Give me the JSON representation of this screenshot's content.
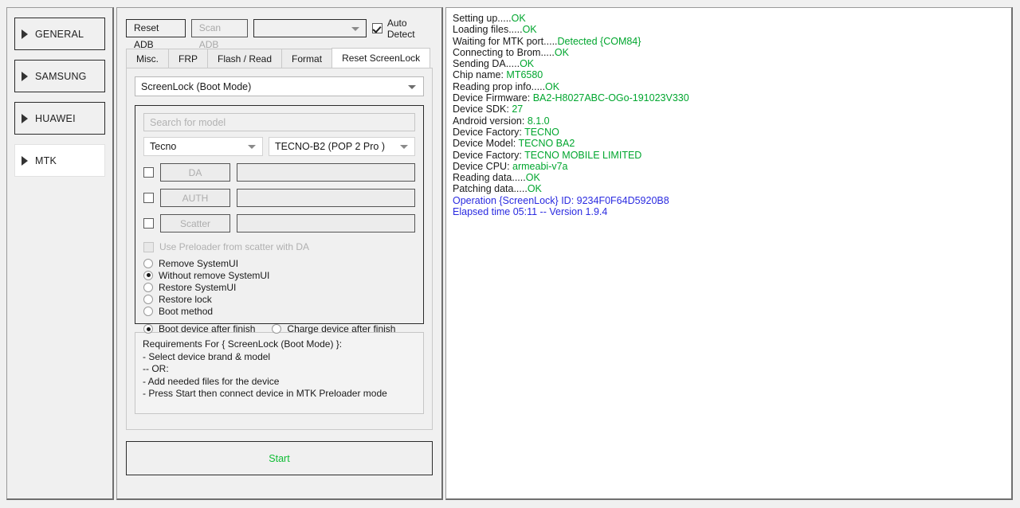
{
  "sidebar": {
    "items": [
      {
        "label": "GENERAL",
        "selected": false
      },
      {
        "label": "SAMSUNG",
        "selected": false
      },
      {
        "label": "HUAWEI",
        "selected": false
      },
      {
        "label": "MTK",
        "selected": true
      }
    ]
  },
  "toolbar": {
    "reset_adb_label": "Reset ADB",
    "scan_adb_label": "Scan ADB",
    "port_value": "",
    "auto_detect_label": "Auto Detect",
    "auto_detect_checked": true
  },
  "tabs": [
    {
      "label": "Misc.",
      "active": false
    },
    {
      "label": "FRP",
      "active": false
    },
    {
      "label": "Flash / Read",
      "active": false
    },
    {
      "label": "Format",
      "active": false
    },
    {
      "label": "Reset ScreenLock",
      "active": true
    }
  ],
  "main": {
    "mode_value": "ScreenLock (Boot Mode)",
    "search_placeholder": "Search for model",
    "search_value": "",
    "brand_value": "Tecno",
    "model_value": "TECNO-B2 (POP 2 Pro )",
    "files": [
      {
        "label": "DA",
        "path": "",
        "checked": false
      },
      {
        "label": "AUTH",
        "path": "",
        "checked": false
      },
      {
        "label": "Scatter",
        "path": "",
        "checked": false
      }
    ],
    "preloader_label": "Use Preloader from scatter with DA",
    "preloader_checked": false,
    "methods": [
      {
        "label": "Remove SystemUI",
        "selected": false
      },
      {
        "label": "Without remove SystemUI",
        "selected": true
      },
      {
        "label": "Restore SystemUI",
        "selected": false
      },
      {
        "label": "Restore lock",
        "selected": false
      },
      {
        "label": "Boot method",
        "selected": false
      }
    ],
    "post_actions": [
      {
        "label": "Boot device after finish",
        "selected": true
      },
      {
        "label": "Charge device after finish",
        "selected": false
      }
    ],
    "requirements": [
      "Requirements For { ScreenLock (Boot Mode) }:",
      " - Select device brand & model",
      " -- OR:",
      " - Add needed files for the device",
      " - Press Start then connect device in MTK Preloader mode"
    ],
    "start_label": "Start"
  },
  "log": {
    "lines": [
      {
        "label": "Setting up.....",
        "value": "OK",
        "style": "ok"
      },
      {
        "label": "Loading files.....",
        "value": "OK",
        "style": "ok"
      },
      {
        "label": "Waiting for MTK port.....",
        "value": "Detected {COM84}",
        "style": "ok"
      },
      {
        "label": "Connecting to Brom.....",
        "value": "OK",
        "style": "ok"
      },
      {
        "label": "Sending DA.....",
        "value": "OK",
        "style": "ok"
      },
      {
        "label": "Chip name: ",
        "value": "MT6580",
        "style": "ok"
      },
      {
        "label": "Reading prop info.....",
        "value": "OK",
        "style": "ok"
      },
      {
        "label": "Device Firmware: ",
        "value": "BA2-H8027ABC-OGo-191023V330",
        "style": "ok"
      },
      {
        "label": "Device SDK: ",
        "value": "27",
        "style": "ok"
      },
      {
        "label": "Android version: ",
        "value": "8.1.0",
        "style": "ok"
      },
      {
        "label": "Device Factory: ",
        "value": "TECNO",
        "style": "ok"
      },
      {
        "label": "Device Model: ",
        "value": "TECNO BA2",
        "style": "ok"
      },
      {
        "label": "Device Factory: ",
        "value": "TECNO MOBILE LIMITED",
        "style": "ok"
      },
      {
        "label": "Device CPU: ",
        "value": "armeabi-v7a",
        "style": "ok"
      },
      {
        "label": "Reading data.....",
        "value": "OK",
        "style": "ok"
      },
      {
        "label": "Patching data.....",
        "value": "OK",
        "style": "ok"
      },
      {
        "label": "Operation {ScreenLock} ID: 9234F0F64D5920B8",
        "value": "",
        "style": "blue"
      },
      {
        "label": "Elapsed time 05:11 -- Version 1.9.4",
        "value": "",
        "style": "blue"
      }
    ]
  },
  "colors": {
    "ok_green": "#00a62e",
    "info_blue": "#2a2ae0",
    "start_green": "#0fbd35",
    "window_bg": "#f0f0f0"
  }
}
